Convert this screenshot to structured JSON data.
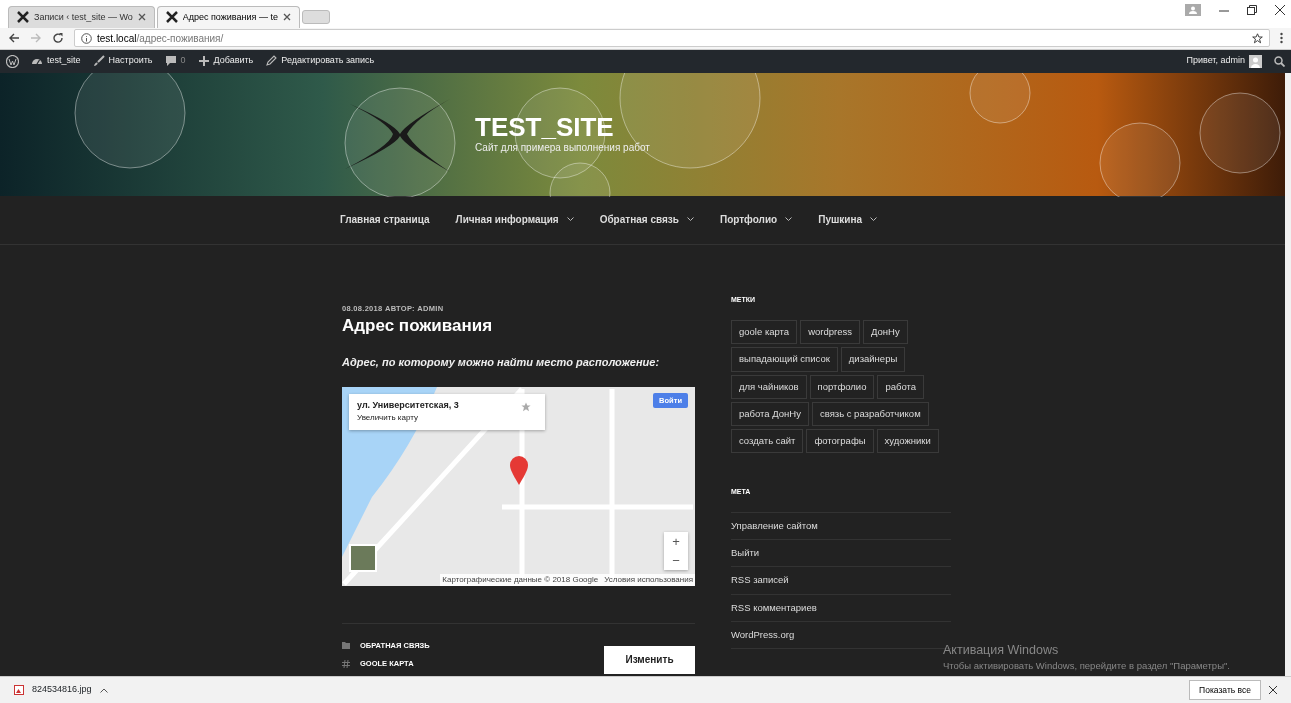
{
  "browser": {
    "tabs": [
      {
        "title": "Записи ‹ test_site — Wo",
        "selected": false
      },
      {
        "title": "Адрес поживания — te",
        "selected": true
      }
    ],
    "address": {
      "host": "test.local",
      "path": "/адрес-поживания/"
    }
  },
  "admin_bar": {
    "items": [
      {
        "kind": "site",
        "label": "test_site"
      },
      {
        "kind": "customize",
        "label": "Настроить"
      },
      {
        "kind": "comments",
        "label": "0"
      },
      {
        "kind": "new",
        "label": "Добавить"
      },
      {
        "kind": "edit",
        "label": "Редактировать запись"
      }
    ],
    "greeting": "Привет, admin"
  },
  "site": {
    "title": "TEST_SITE",
    "tagline": "Сайт для примера выполнения работ"
  },
  "menu": [
    {
      "label": "Главная страница",
      "has_submenu": false
    },
    {
      "label": "Личная информация",
      "has_submenu": true
    },
    {
      "label": "Обратная связь",
      "has_submenu": true
    },
    {
      "label": "Портфолио",
      "has_submenu": true
    },
    {
      "label": "Пушкина",
      "has_submenu": true
    }
  ],
  "post": {
    "date": "08.08.2018",
    "author": "АВТОР: ADMIN",
    "title": "Адрес поживания",
    "lead": "Адрес, по которому можно найти место расположение:",
    "map": {
      "place": "ул. Университетская, 3",
      "enlarge_link": "Увеличить карту",
      "sign_in": "Войти",
      "zoom_in": "+",
      "zoom_out": "−",
      "attribution": "Картографические данные © 2018 Google",
      "terms": "Условия использования"
    },
    "category": "ОБРАТНАЯ СВЯЗЬ",
    "tag": "GOOLE КАРТА",
    "edit_button": "Изменить"
  },
  "sidebar": {
    "tags_title": "МЕТКИ",
    "tags": [
      [
        "goole карта",
        "wordpress",
        "ДонНу"
      ],
      [
        "выпадающий список",
        "дизайнеры"
      ],
      [
        "для чайников",
        "портфолио",
        "работа"
      ],
      [
        "работа ДонНу",
        "связь с разработчиком"
      ],
      [
        "создать сайт",
        "фотографы",
        "художники"
      ]
    ],
    "meta_title": "МЕТА",
    "meta_links": [
      "Управление сайтом",
      "Выйти",
      "RSS записей",
      "RSS комментариев",
      "WordPress.org"
    ]
  },
  "windows_notice": {
    "title": "Активация Windows",
    "text": "Чтобы активировать Windows, перейдите в раздел \"Параметры\"."
  },
  "download_bar": {
    "file": "824534816.jpg",
    "show_all": "Показать все"
  }
}
